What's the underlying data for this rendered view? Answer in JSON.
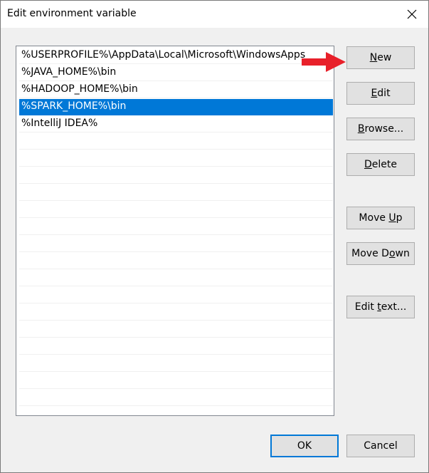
{
  "window": {
    "title": "Edit environment variable"
  },
  "list": {
    "items": [
      {
        "text": "%USERPROFILE%\\AppData\\Local\\Microsoft\\WindowsApps",
        "selected": false
      },
      {
        "text": "%JAVA_HOME%\\bin",
        "selected": false
      },
      {
        "text": "%HADOOP_HOME%\\bin",
        "selected": false
      },
      {
        "text": "%SPARK_HOME%\\bin",
        "selected": true
      },
      {
        "text": "%IntelliJ IDEA%",
        "selected": false
      }
    ],
    "selected_color": "#0078d7"
  },
  "buttons": {
    "new": {
      "pre": "",
      "u": "N",
      "post": "ew"
    },
    "edit": {
      "pre": "",
      "u": "E",
      "post": "dit"
    },
    "browse": {
      "pre": "",
      "u": "B",
      "post": "rowse..."
    },
    "delete": {
      "pre": "",
      "u": "D",
      "post": "elete"
    },
    "move_up": {
      "pre": "Move ",
      "u": "U",
      "post": "p"
    },
    "move_down": {
      "pre": "Move D",
      "u": "o",
      "post": "wn"
    },
    "edit_text": {
      "pre": "Edit ",
      "u": "t",
      "post": "ext..."
    },
    "ok": "OK",
    "cancel": "Cancel"
  },
  "annotation": {
    "arrow_color": "#e8202a",
    "icon": "red-arrow-icon"
  }
}
